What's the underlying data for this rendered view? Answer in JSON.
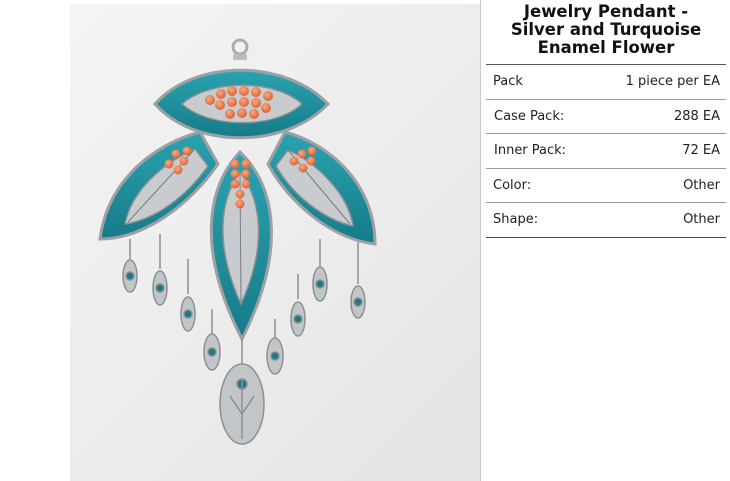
{
  "product": {
    "title_line1": "Jewelry Pendant -",
    "title_line2": "Silver and Turquoise",
    "title_line3": "Enamel Flower",
    "image_alt": "Silver and turquoise enamel flower pendant with orange beads and dangling leaf charms"
  },
  "specs": [
    {
      "label": "Pack",
      "value": "1 piece per EA"
    },
    {
      "label": "Case Pack:",
      "value": "288 EA"
    },
    {
      "label": "Inner Pack:",
      "value": "72 EA"
    },
    {
      "label": "Color:",
      "value": "Other"
    },
    {
      "label": "Shape:",
      "value": "Other"
    }
  ],
  "colors": {
    "enamel": "#1f8f9e",
    "bead": "#e8784a",
    "silver": "#b9bcbf"
  }
}
